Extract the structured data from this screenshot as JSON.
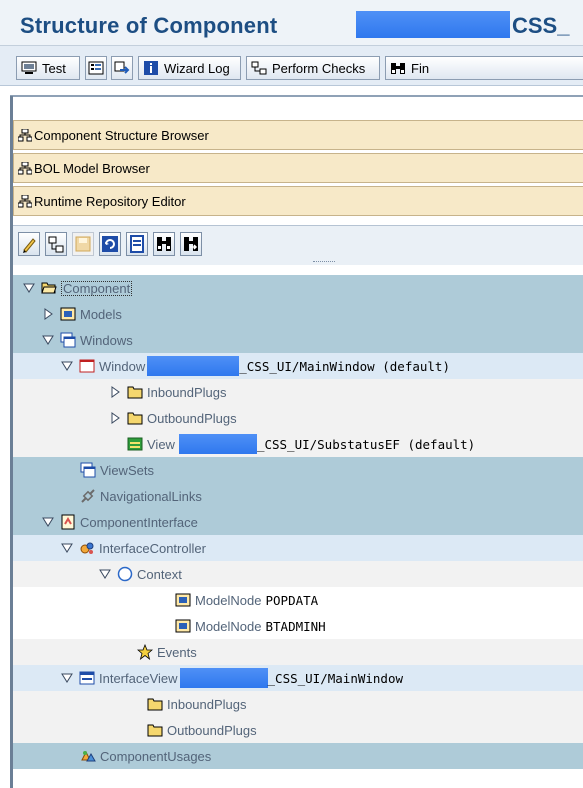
{
  "title": {
    "text": "Structure of Component",
    "suffix": "CSS_"
  },
  "toolbar": {
    "test_label": "Test",
    "wizard_log_label": "Wizard Log",
    "perform_checks_label": "Perform Checks",
    "find_label": "Fin"
  },
  "trays": {
    "component_structure": "Component Structure Browser",
    "bol_model": "BOL Model Browser",
    "runtime_repository": "Runtime Repository Editor"
  },
  "tree": {
    "component": "Component",
    "models": "Models",
    "windows": "Windows",
    "window_prefix": "Window",
    "window_suffix": "_CSS_UI/MainWindow (default)",
    "window_inbound": "InboundPlugs",
    "window_outbound": "OutboundPlugs",
    "view_prefix": "View",
    "view_suffix": "_CSS_UI/SubstatusEF (default)",
    "viewsets": "ViewSets",
    "navigational_links": "NavigationalLinks",
    "component_interface": "ComponentInterface",
    "interface_controller": "InterfaceController",
    "context": "Context",
    "model_node_1_prefix": "ModelNode",
    "model_node_1_name": "POPDATA",
    "model_node_2_prefix": "ModelNode",
    "model_node_2_name": "BTADMINH",
    "events": "Events",
    "interface_view_prefix": "InterfaceView",
    "interface_view_suffix": "_CSS_UI/MainWindow",
    "iv_inbound": "InboundPlugs",
    "iv_outbound": "OutboundPlugs",
    "component_usages": "ComponentUsages"
  },
  "colors": {
    "title": "#1d4e83",
    "redaction": "#3f86f4",
    "tray": "#f7e9c8",
    "row_highlight": "#aecbd8",
    "row_selected": "#dce9f5"
  }
}
